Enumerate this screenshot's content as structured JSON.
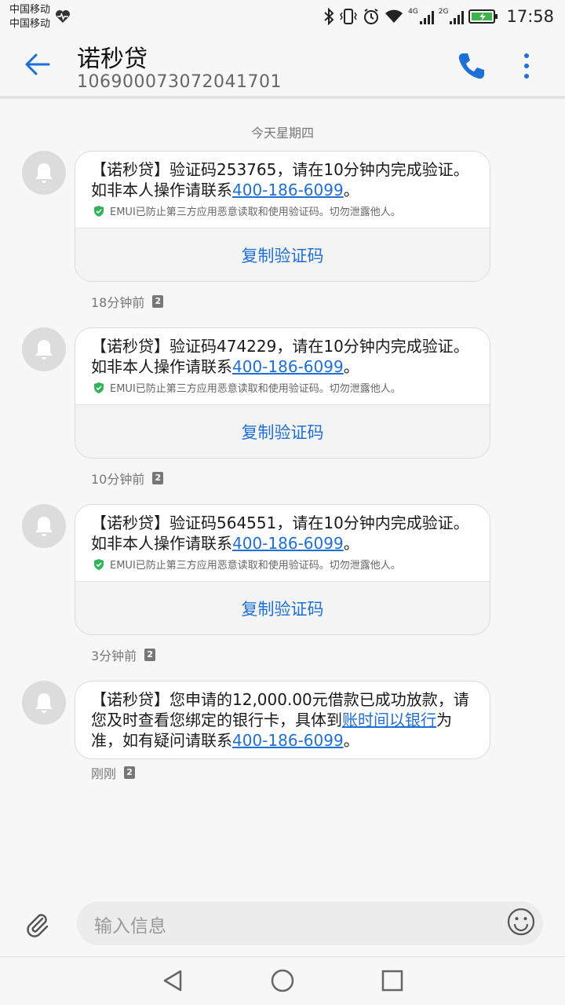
{
  "status_bar": {
    "carrier_1": "中国移动",
    "carrier_2": "中国移动",
    "time": "17:58",
    "network_1": "4G",
    "network_2": "2G",
    "icons": [
      "heart-icon",
      "bluetooth-icon",
      "vibrate-icon",
      "alarm-icon",
      "wifi-icon",
      "signal-icon",
      "battery-icon"
    ]
  },
  "header": {
    "title": "诺秒贷",
    "number": "106900073072041701",
    "back_icon": "arrow-left-icon",
    "call_icon": "phone-icon",
    "more_icon": "more-vertical-icon",
    "accent_color": "#1f6fd8"
  },
  "date_separator": "今天星期四",
  "messages": [
    {
      "text_prefix": "【诺秒贷】验证码253765，请在10分钟内完成验证。如非本人操作请联系",
      "phone": "400-186-6099",
      "text_suffix": "。",
      "emui_note": "EMUI已防止第三方应用恶意读取和使用验证码。切勿泄露他人。",
      "copy_label": "复制验证码",
      "time": "18分钟前",
      "sim": "2"
    },
    {
      "text_prefix": "【诺秒贷】验证码474229，请在10分钟内完成验证。如非本人操作请联系",
      "phone": "400-186-6099",
      "text_suffix": "。",
      "emui_note": "EMUI已防止第三方应用恶意读取和使用验证码。切勿泄露他人。",
      "copy_label": "复制验证码",
      "time": "10分钟前",
      "sim": "2"
    },
    {
      "text_prefix": "【诺秒贷】验证码564551，请在10分钟内完成验证。如非本人操作请联系",
      "phone": "400-186-6099",
      "text_suffix": "。",
      "emui_note": "EMUI已防止第三方应用恶意读取和使用验证码。切勿泄露他人。",
      "copy_label": "复制验证码",
      "time": "3分钟前",
      "sim": "2"
    },
    {
      "text_1": "【诺秒贷】您申请的12,000.00元借款已成功放款，请您及时查看您绑定的银行卡，具体到",
      "link_1": "账时间以银行",
      "text_2": "为准，如有疑问请联系",
      "phone": "400-186-6099",
      "text_3": "。",
      "time": "刚刚",
      "sim": "2"
    }
  ],
  "input": {
    "placeholder": "输入信息",
    "attach_icon": "paperclip-icon",
    "emoji_icon": "smiley-icon"
  },
  "navbar": {
    "icons": [
      "nav-back-icon",
      "nav-home-icon",
      "nav-recent-icon"
    ]
  }
}
